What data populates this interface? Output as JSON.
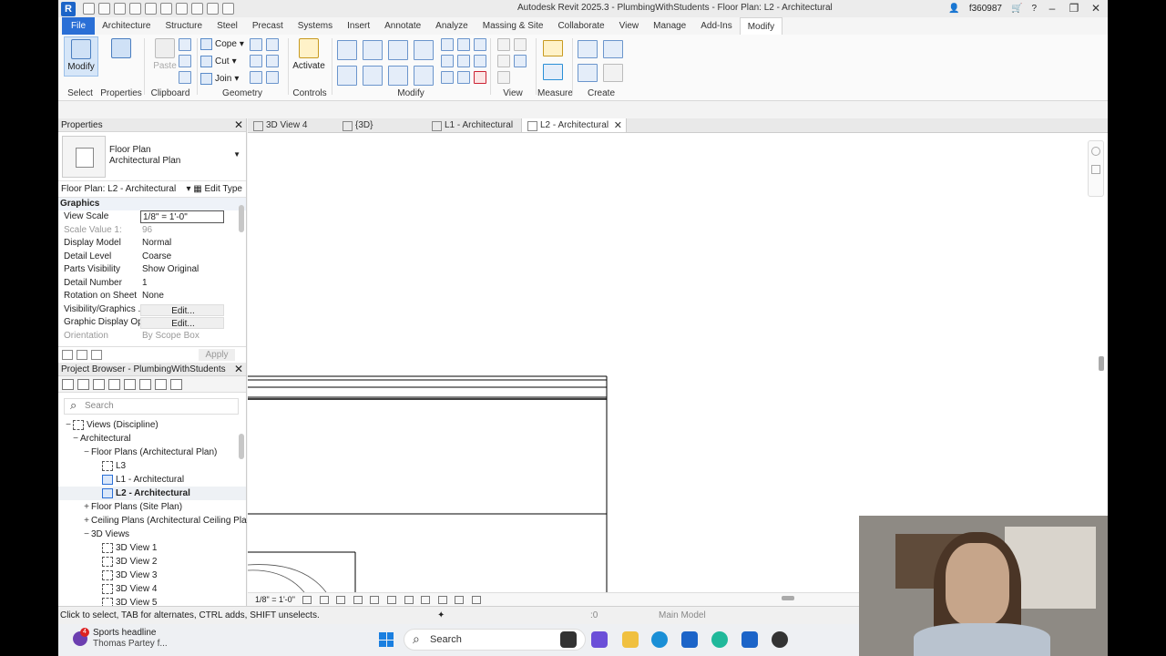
{
  "app": {
    "logo": "R",
    "title": "Autodesk Revit 2025.3 - PlumbingWithStudents - Floor Plan: L2 - Architectural",
    "user": "f360987"
  },
  "ribbon": {
    "tabs": [
      "File",
      "Architecture",
      "Structure",
      "Steel",
      "Precast",
      "Systems",
      "Insert",
      "Annotate",
      "Analyze",
      "Massing & Site",
      "Collaborate",
      "View",
      "Manage",
      "Add-Ins",
      "Modify"
    ],
    "active_tab": "Modify",
    "modify_label": "Modify",
    "properties_label": "Properties",
    "paste_label": "Paste",
    "cope_label": "Cope",
    "cut_label": "Cut",
    "join_label": "Join",
    "activate_label": "Activate",
    "groups": {
      "select": "Select",
      "properties": "Properties",
      "clipboard": "Clipboard",
      "geometry": "Geometry",
      "controls": "Controls",
      "modify": "Modify",
      "view": "View",
      "measure": "Measure",
      "create": "Create"
    }
  },
  "properties": {
    "title": "Properties",
    "type_line1": "Floor Plan",
    "type_line2": "Architectural Plan",
    "instance": "Floor Plan: L2 - Architectural",
    "edit_type": "Edit Type",
    "section": "Graphics",
    "rows": [
      {
        "k": "View Scale",
        "v": "1/8\" = 1'-0\""
      },
      {
        "k": "Scale Value    1:",
        "v": "96"
      },
      {
        "k": "Display Model",
        "v": "Normal"
      },
      {
        "k": "Detail Level",
        "v": "Coarse"
      },
      {
        "k": "Parts Visibility",
        "v": "Show Original"
      },
      {
        "k": "Detail Number",
        "v": "1"
      },
      {
        "k": "Rotation on Sheet",
        "v": "None"
      },
      {
        "k": "Visibility/Graphics ...",
        "v": "Edit..."
      },
      {
        "k": "Graphic Display Op...",
        "v": "Edit..."
      },
      {
        "k": "Orientation",
        "v": "By Scope Box"
      }
    ],
    "apply": "Apply"
  },
  "browser": {
    "title": "Project Browser - PlumbingWithStudents",
    "search_placeholder": "Search",
    "nodes": [
      {
        "label": "Views (Discipline)",
        "toggle": "−"
      },
      {
        "label": "Architectural",
        "toggle": "−"
      },
      {
        "label": "Floor Plans (Architectural Plan)",
        "toggle": "−"
      },
      {
        "label": "L3",
        "toggle": ""
      },
      {
        "label": "L1 - Architectural",
        "toggle": ""
      },
      {
        "label": "L2 - Architectural",
        "toggle": ""
      },
      {
        "label": "Floor Plans (Site Plan)",
        "toggle": "+"
      },
      {
        "label": "Ceiling Plans (Architectural Ceiling Pla",
        "toggle": "+"
      },
      {
        "label": "3D Views",
        "toggle": "−"
      },
      {
        "label": "3D View 1",
        "toggle": ""
      },
      {
        "label": "3D View 2",
        "toggle": ""
      },
      {
        "label": "3D View 3",
        "toggle": ""
      },
      {
        "label": "3D View 4",
        "toggle": ""
      },
      {
        "label": "3D View 5",
        "toggle": ""
      }
    ]
  },
  "view_tabs": [
    "3D View 4",
    "{3D}",
    "L1 - Architectural",
    "L2 - Architectural"
  ],
  "view_control": {
    "scale": "1/8\" = 1'-0\""
  },
  "status": {
    "hint": "Click to select, TAB for alternates, CTRL adds, SHIFT unselects.",
    "selection_count": ":0",
    "model": "Main Model"
  },
  "taskbar": {
    "news_title": "Sports headline",
    "news_sub": "Thomas Partey f...",
    "news_badge": "4",
    "search": "Search"
  },
  "colors": {
    "accent": "#2a6fd6",
    "file_tab": "#2a6fd6",
    "selection": "#d6e6f8"
  }
}
